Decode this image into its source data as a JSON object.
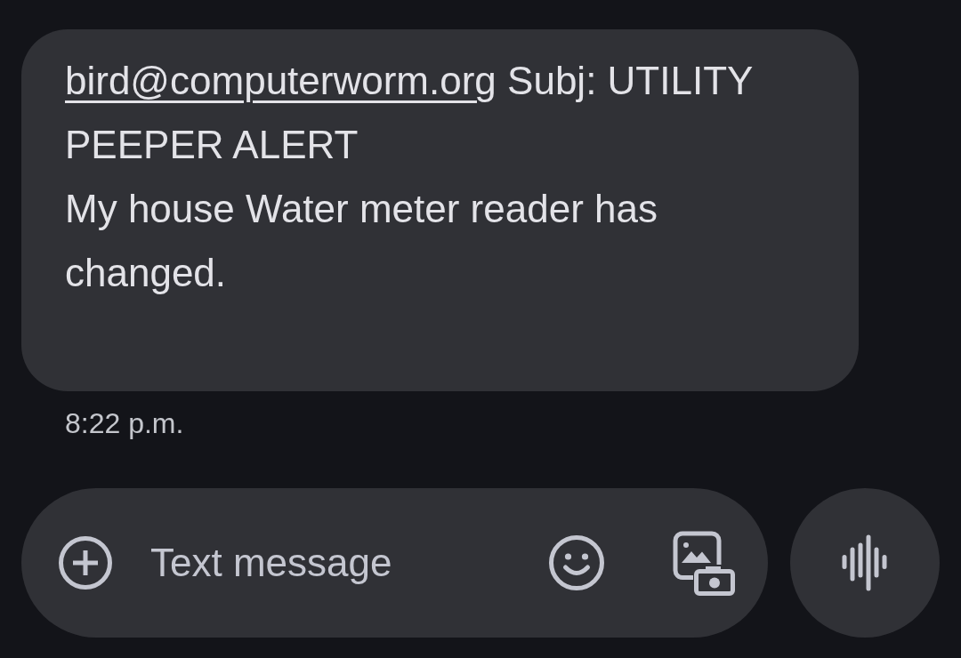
{
  "messages": [
    {
      "sender_link": "bird@computerworm.org",
      "body": "Subj: UTILITY PEEPER ALERT\nMy house Water meter reader has changed.",
      "time": "8:22 p.m."
    }
  ],
  "composer": {
    "placeholder": "Text message"
  }
}
